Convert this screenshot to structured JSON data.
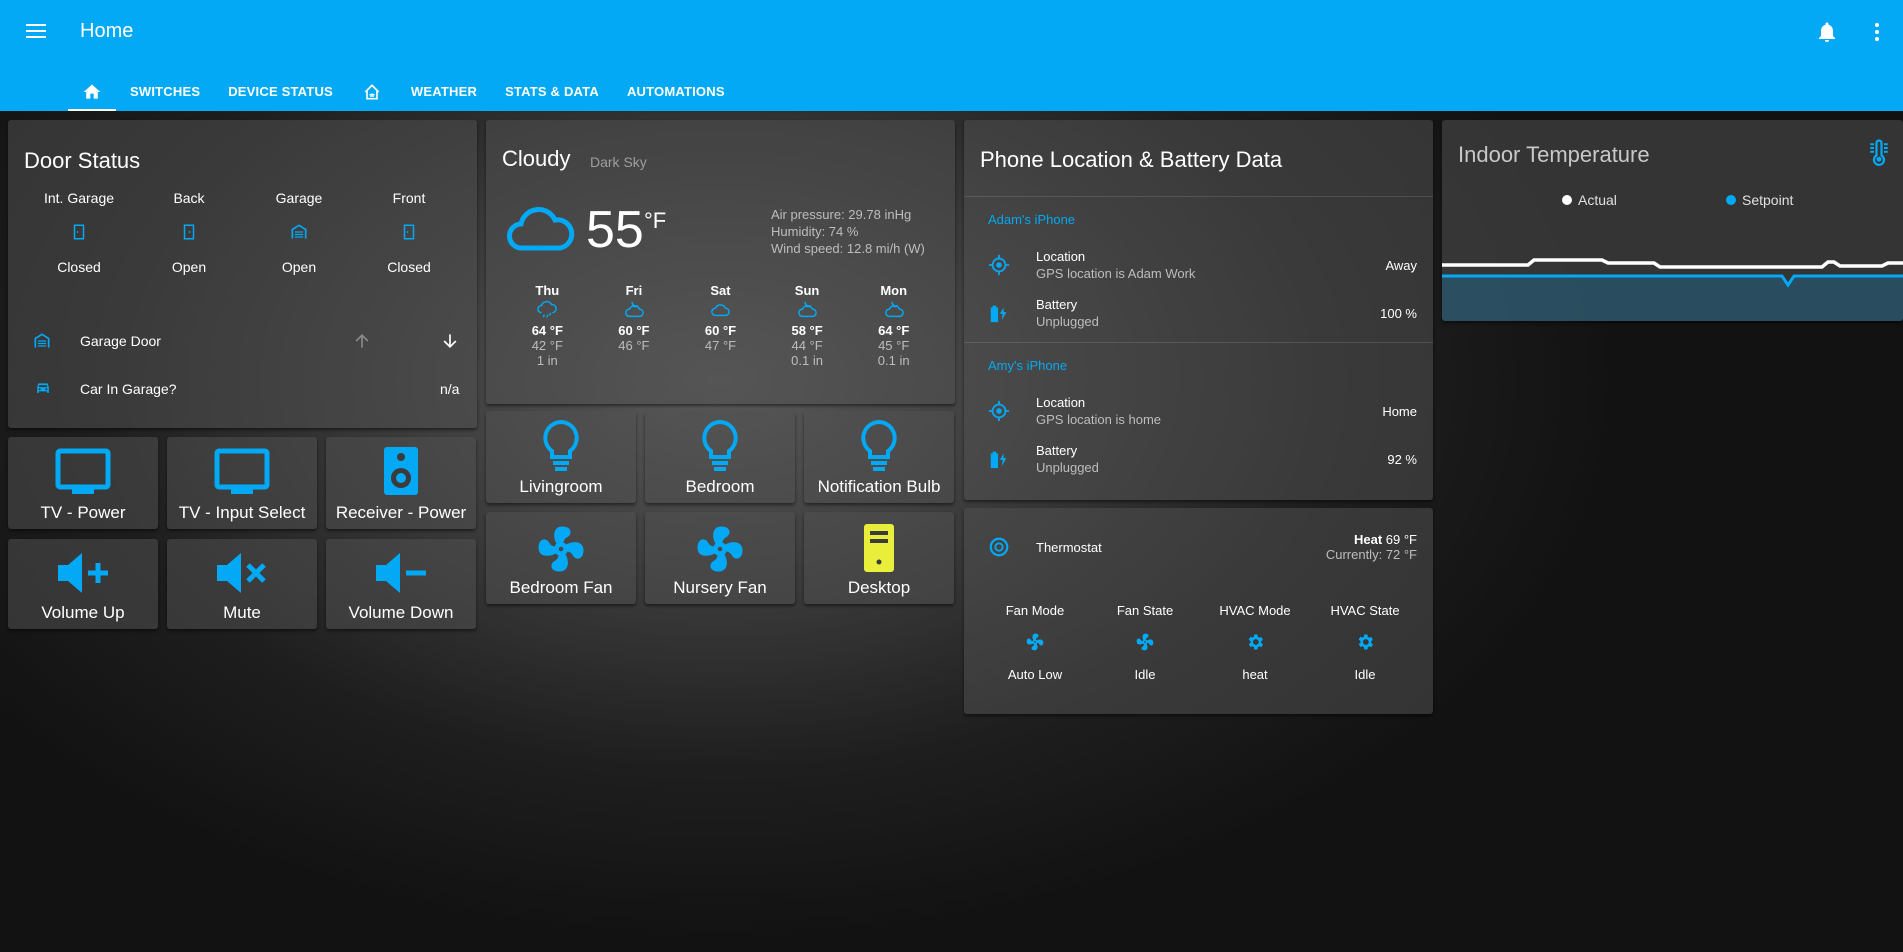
{
  "header": {
    "title": "Home",
    "tabs": [
      "SWITCHES",
      "DEVICE STATUS",
      "WEATHER",
      "STATS & DATA",
      "AUTOMATIONS"
    ]
  },
  "doors": {
    "title": "Door Status",
    "items": [
      {
        "name": "Int. Garage",
        "state": "Closed"
      },
      {
        "name": "Back",
        "state": "Open"
      },
      {
        "name": "Garage",
        "state": "Open"
      },
      {
        "name": "Front",
        "state": "Closed"
      }
    ],
    "garage_door": "Garage Door",
    "car_label": "Car In Garage?",
    "car_value": "n/a"
  },
  "media_buttons": [
    {
      "label": "TV - Power",
      "icon": "tv-icon"
    },
    {
      "label": "TV - Input Select",
      "icon": "tv-icon"
    },
    {
      "label": "Receiver - Power",
      "icon": "speaker-icon"
    },
    {
      "label": "Volume Up",
      "icon": "volume-plus-icon"
    },
    {
      "label": "Mute",
      "icon": "volume-mute-icon"
    },
    {
      "label": "Volume Down",
      "icon": "volume-minus-icon"
    }
  ],
  "weather": {
    "condition": "Cloudy",
    "source": "Dark Sky",
    "temp": "55",
    "unit": "°F",
    "pressure": "Air pressure: 29.78 inHg",
    "humidity": "Humidity: 74 %",
    "wind": "Wind speed: 12.8 mi/h (W)",
    "forecast": [
      {
        "day": "Thu",
        "high": "64 °F",
        "low": "42 °F",
        "precip": "1 in",
        "icon": "cloud-rain-icon"
      },
      {
        "day": "Fri",
        "high": "60 °F",
        "low": "46 °F",
        "precip": "",
        "icon": "partly-cloudy-night-icon"
      },
      {
        "day": "Sat",
        "high": "60 °F",
        "low": "47 °F",
        "precip": "",
        "icon": "cloud-icon"
      },
      {
        "day": "Sun",
        "high": "58 °F",
        "low": "44 °F",
        "precip": "0.1 in",
        "icon": "partly-cloudy-night-icon"
      },
      {
        "day": "Mon",
        "high": "64 °F",
        "low": "45 °F",
        "precip": "0.1 in",
        "icon": "partly-cloudy-night-icon"
      }
    ]
  },
  "light_buttons": [
    {
      "label": "Livingroom",
      "icon": "bulb-icon"
    },
    {
      "label": "Bedroom",
      "icon": "bulb-icon"
    },
    {
      "label": "Notification Bulb",
      "icon": "bulb-icon"
    },
    {
      "label": "Bedroom Fan",
      "icon": "fan-icon"
    },
    {
      "label": "Nursery Fan",
      "icon": "fan-icon"
    },
    {
      "label": "Desktop",
      "icon": "desktop-tower-icon"
    }
  ],
  "phones": {
    "title": "Phone Location & Battery Data",
    "devices": [
      {
        "name": "Adam's iPhone",
        "loc_label": "Location",
        "loc_sub": "GPS location is Adam Work",
        "loc_value": "Away",
        "bat_label": "Battery",
        "bat_sub": "Unplugged",
        "bat_value": "100 %"
      },
      {
        "name": "Amy's iPhone",
        "loc_label": "Location",
        "loc_sub": "GPS location is home",
        "loc_value": "Home",
        "bat_label": "Battery",
        "bat_sub": "Unplugged",
        "bat_value": "92 %"
      }
    ]
  },
  "thermostat": {
    "label": "Thermostat",
    "mode": "Heat",
    "target": "69 °F",
    "current": "Currently: 72 °F",
    "attrs": [
      {
        "name": "Fan Mode",
        "value": "Auto Low",
        "icon": "fan-icon"
      },
      {
        "name": "Fan State",
        "value": "Idle",
        "icon": "fan-icon"
      },
      {
        "name": "HVAC Mode",
        "value": "heat",
        "icon": "gear-icon"
      },
      {
        "name": "HVAC State",
        "value": "Idle",
        "icon": "gear-icon"
      }
    ]
  },
  "indoor": {
    "title": "Indoor Temperature",
    "legend": [
      "Actual",
      "Setpoint"
    ],
    "colors": {
      "actual": "#ffffff",
      "setpoint": "#03a9f4"
    }
  }
}
